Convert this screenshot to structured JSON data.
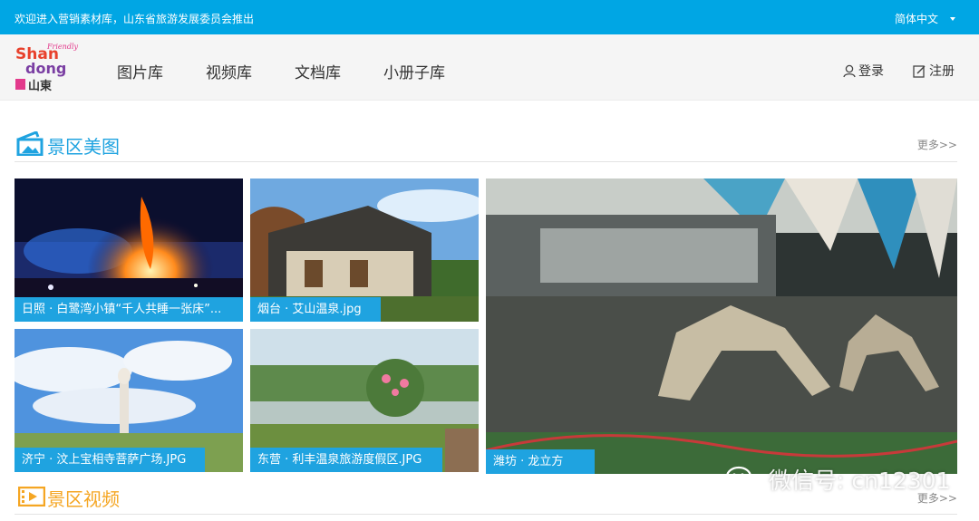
{
  "topbar": {
    "welcome": "欢迎进入营销素材库，山东省旅游发展委员会推出",
    "language": "简体中文"
  },
  "logo": {
    "line1": "Shan",
    "line2": "dong",
    "tag": "Friendly",
    "chinese": "山東"
  },
  "nav": [
    "图片库",
    "视频库",
    "文档库",
    "小册子库"
  ],
  "auth": {
    "login": "登录",
    "register": "注册"
  },
  "section_images": {
    "title": "景区美图",
    "more": "更多>>"
  },
  "section_videos": {
    "title": "景区视频",
    "more": "更多>>"
  },
  "gallery": [
    "日照 · 白鹭湾小镇“千人共睡一张床”...",
    "烟台 · 艾山温泉.jpg",
    "济宁 · 汶上宝相寺菩萨广场.JPG",
    "东营 · 利丰温泉旅游度假区.JPG",
    "潍坊 · 龙立方"
  ],
  "watermark": "微信号: cn12301",
  "colors": {
    "accent": "#00a6e4",
    "caption_bg": "#1fa3e0",
    "video_accent": "#f5a623"
  }
}
